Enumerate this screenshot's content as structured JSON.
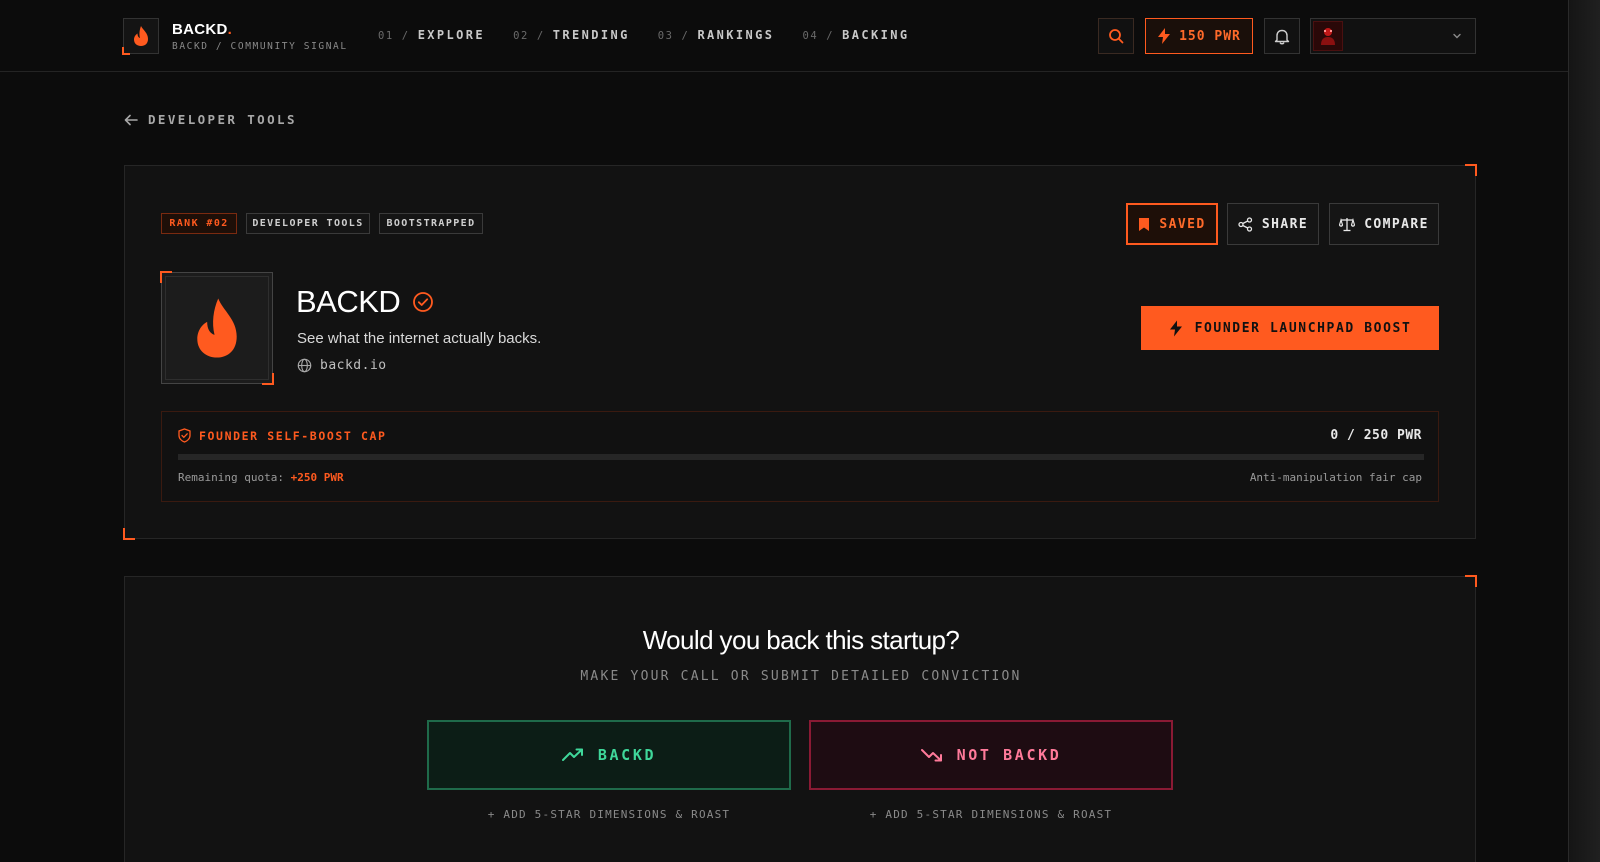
{
  "brand": {
    "name": "BACKD",
    "dot": ".",
    "subtitle": "BACKD / COMMUNITY SIGNAL"
  },
  "nav": [
    {
      "num": "01 /",
      "label": "EXPLORE"
    },
    {
      "num": "02 /",
      "label": "TRENDING"
    },
    {
      "num": "03 /",
      "label": "RANKINGS"
    },
    {
      "num": "04 /",
      "label": "BACKING"
    }
  ],
  "header": {
    "power_label": "150 PWR"
  },
  "back": {
    "label": "DEVELOPER TOOLS"
  },
  "startup": {
    "tags": {
      "rank": "RANK #02",
      "category": "DEVELOPER TOOLS",
      "stage": "BOOTSTRAPPED"
    },
    "actions": {
      "saved": "SAVED",
      "share": "SHARE",
      "compare": "COMPARE"
    },
    "name": "BACKD",
    "tagline": "See what the internet actually backs.",
    "website": "backd.io",
    "boost_label": "FOUNDER LAUNCHPAD BOOST"
  },
  "cap": {
    "title": "FOUNDER SELF-BOOST CAP",
    "value_text": "0 / 250 PWR",
    "progress": 0,
    "remaining_label": "Remaining quota:",
    "remaining_value": "+250 PWR",
    "note": "Anti-manipulation fair cap"
  },
  "vote": {
    "question": "Would you back this startup?",
    "subtitle": "MAKE YOUR CALL OR SUBMIT DETAILED CONVICTION",
    "yes_label": "BACKD",
    "no_label": "NOT BACKD",
    "yes_hint": "+ ADD 5-STAR DIMENSIONS & ROAST",
    "no_hint": "+ ADD 5-STAR DIMENSIONS & ROAST"
  },
  "colors": {
    "accent": "#ff5a1f",
    "positive": "#3fd79a",
    "negative": "#ff7a9a",
    "background": "#0c0c0c"
  },
  "icons": [
    "flame-icon",
    "search-icon",
    "bolt-icon",
    "bell-icon",
    "chevron-down-icon",
    "arrow-left-icon",
    "bookmark-icon",
    "share-icon",
    "scale-icon",
    "verified-icon",
    "globe-icon",
    "shield-icon",
    "trend-up-icon",
    "trend-down-icon"
  ]
}
